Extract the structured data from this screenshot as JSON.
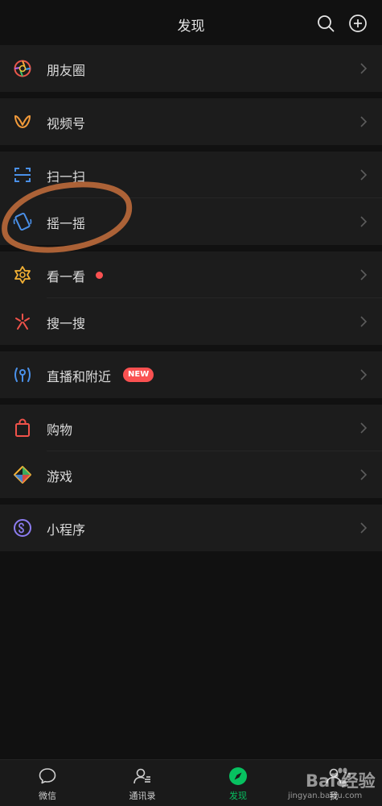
{
  "header": {
    "title": "发现"
  },
  "groups": [
    [
      {
        "id": "moments",
        "label": "朋友圈",
        "icon": "moments-icon"
      }
    ],
    [
      {
        "id": "channels",
        "label": "视频号",
        "icon": "channels-icon"
      }
    ],
    [
      {
        "id": "scan",
        "label": "扫一扫",
        "icon": "scan-icon"
      },
      {
        "id": "shake",
        "label": "摇一摇",
        "icon": "shake-icon"
      }
    ],
    [
      {
        "id": "top-stories",
        "label": "看一看",
        "icon": "top-stories-icon",
        "badge": "dot"
      },
      {
        "id": "search",
        "label": "搜一搜",
        "icon": "search-sparkle-icon"
      }
    ],
    [
      {
        "id": "live-nearby",
        "label": "直播和附近",
        "icon": "live-icon",
        "badge": "NEW"
      }
    ],
    [
      {
        "id": "shopping",
        "label": "购物",
        "icon": "shopping-bag-icon"
      },
      {
        "id": "games",
        "label": "游戏",
        "icon": "games-icon"
      }
    ],
    [
      {
        "id": "mini-programs",
        "label": "小程序",
        "icon": "mini-program-icon"
      }
    ]
  ],
  "tabs": [
    {
      "id": "chats",
      "label": "微信",
      "icon": "chat-bubble-icon",
      "active": false
    },
    {
      "id": "contacts",
      "label": "通讯录",
      "icon": "contacts-icon",
      "active": false
    },
    {
      "id": "discover",
      "label": "发现",
      "icon": "compass-icon",
      "active": true
    },
    {
      "id": "me",
      "label": "我",
      "icon": "person-icon",
      "active": false
    }
  ],
  "watermark": {
    "brand": "Bai  经验",
    "url": "jingyan.baidu.com"
  },
  "colors": {
    "accent": "#07c160",
    "badge": "#fa5151",
    "annotation": "#b8683a",
    "background": "#111111",
    "cell": "#1c1c1c"
  }
}
